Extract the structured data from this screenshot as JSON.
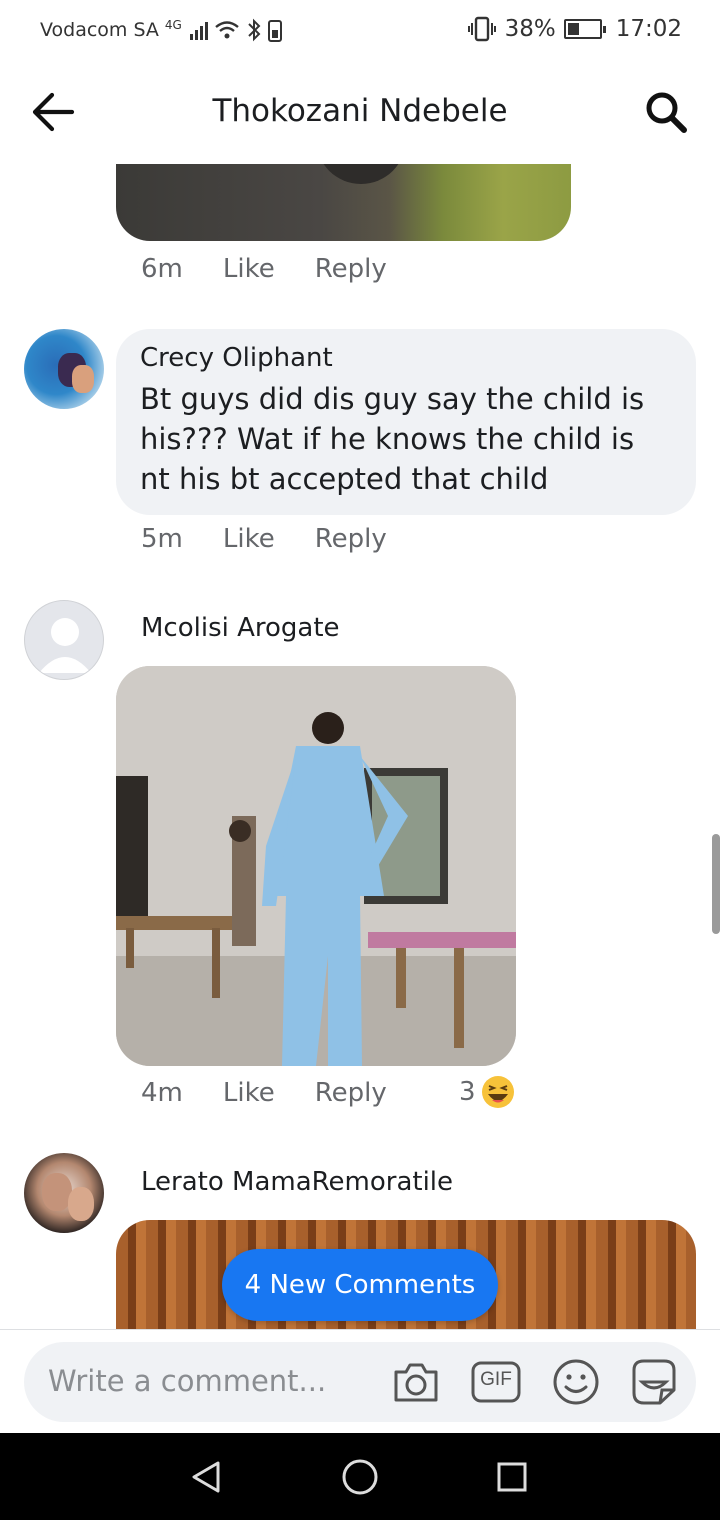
{
  "status_bar": {
    "carrier": "Vodacom SA",
    "network": "4G",
    "battery_percent": "38%",
    "battery_level": 0.38,
    "time": "17:02"
  },
  "header": {
    "title": "Thokozani Ndebele",
    "back_icon": "arrow-left-icon",
    "search_icon": "search-icon"
  },
  "comments": [
    {
      "time": "6m",
      "like_label": "Like",
      "reply_label": "Reply"
    },
    {
      "author": "Crecy Oliphant",
      "text": "Bt guys did dis guy say the child is his??? Wat if he knows the child is nt his bt accepted that child",
      "time": "5m",
      "like_label": "Like",
      "reply_label": "Reply"
    },
    {
      "author": "Mcolisi Arogate",
      "time": "4m",
      "like_label": "Like",
      "reply_label": "Reply",
      "reaction_count": "3",
      "reaction_icon": "laughing-emoji-icon"
    },
    {
      "author": "Lerato MamaRemoratile"
    }
  ],
  "new_comments_label": "4 New Comments",
  "composer": {
    "placeholder": "Write a comment...",
    "icons": [
      "camera-icon",
      "gif-icon",
      "emoji-icon",
      "sticker-icon"
    ],
    "gif_label": "GIF"
  },
  "nav_bar": {
    "icons": [
      "back-triangle-icon",
      "home-circle-icon",
      "recents-square-icon"
    ]
  },
  "colors": {
    "accent": "#1877f2",
    "bubble": "#f0f2f5",
    "meta_text": "#65676b"
  }
}
